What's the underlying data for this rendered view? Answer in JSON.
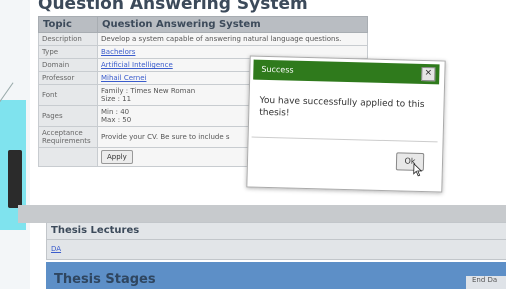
{
  "page": {
    "title": "Question Answering System"
  },
  "table": {
    "header": {
      "col1": "Topic",
      "col2": "Question Answering System"
    },
    "rows": {
      "description": {
        "label": "Description",
        "value": "Develop a system capable of answering natural language questions."
      },
      "type": {
        "label": "Type",
        "value": "Bachelors"
      },
      "domain": {
        "label": "Domain",
        "value": "Artificial Intelligence"
      },
      "professor": {
        "label": "Professor",
        "value": "Mihail Cernei"
      },
      "font": {
        "label": "Font",
        "family": "Family : Times New Roman",
        "size": "Size : 11"
      },
      "pages": {
        "label": "Pages",
        "min": "Min : 40",
        "max": "Max : 50"
      },
      "acceptance": {
        "label1": "Acceptance",
        "label2": "Requirements",
        "value": "Provide your CV. Be sure to include s"
      }
    },
    "apply_label": "Apply"
  },
  "lectures": {
    "title": "Thesis Lectures",
    "link": "DA"
  },
  "stages": {
    "title": "Thesis Stages",
    "col_label": "End Da"
  },
  "dialog": {
    "title": "Success",
    "close_symbol": "×",
    "message": "You have successfully applied to this thesis!",
    "ok_label": "Ok"
  }
}
